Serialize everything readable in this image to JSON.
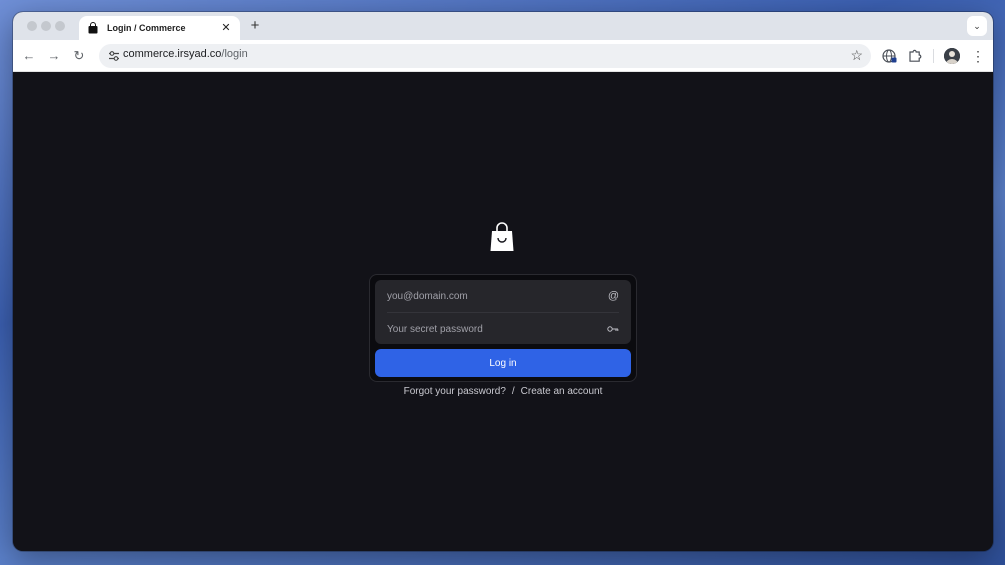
{
  "browser": {
    "tab": {
      "title": "Login / Commerce",
      "favicon": "shopping-bag-icon",
      "close_glyph": "✕"
    },
    "new_tab_glyph": "+",
    "tab_search_glyph": "⌄",
    "nav": {
      "back_glyph": "←",
      "forward_glyph": "→",
      "reload_glyph": "↻"
    },
    "address": {
      "domain": "commerce.irsyad.co",
      "path": "/login"
    },
    "star_glyph": "☆",
    "menu_glyph": "⋮"
  },
  "page": {
    "logo_icon": "shopping-bag-icon",
    "email": {
      "placeholder": "you@domain.com",
      "value": "",
      "icon_glyph": "@"
    },
    "password": {
      "placeholder": "Your secret password",
      "value": "",
      "icon_glyph": "⚿"
    },
    "login_label": "Log in",
    "forgot_link": "Forgot your password?",
    "separator": "/",
    "create_link": "Create an account"
  },
  "colors": {
    "page_bg": "#121218",
    "card_bg": "#0b0b0f",
    "field_bg": "#26262b",
    "accent": "#2f63e6"
  }
}
